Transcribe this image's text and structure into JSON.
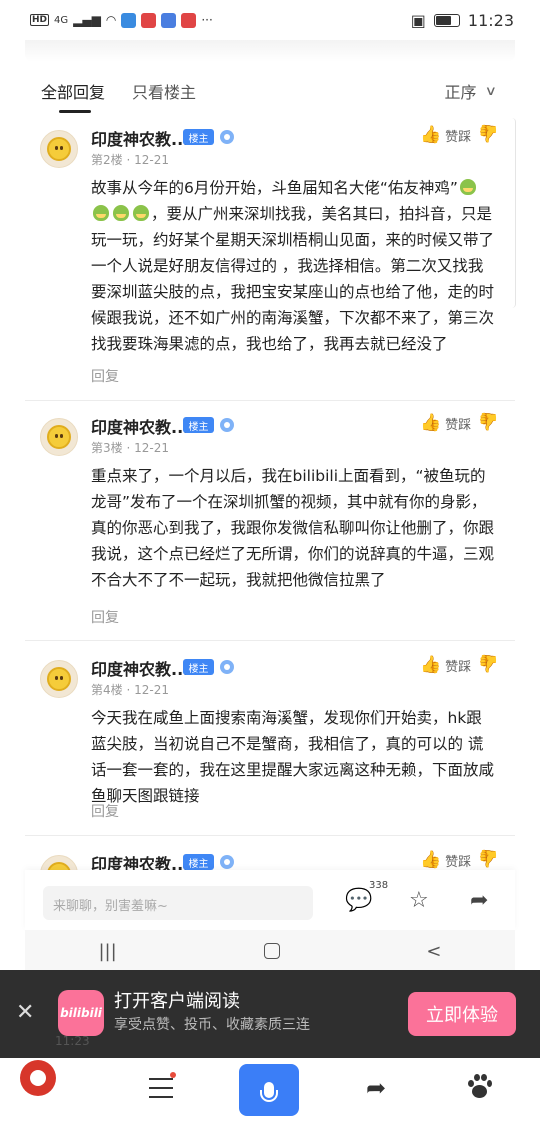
{
  "status_bar": {
    "hd": "HD",
    "network": "4G",
    "time": "11:23",
    "app_colors": [
      "#3a8be0",
      "#e04545",
      "#4a7ee0",
      "#e04545"
    ]
  },
  "tabs": {
    "all": "全部回复",
    "owner_only": "只看楼主",
    "sort": "正序"
  },
  "posts": [
    {
      "user": "印度神农教...",
      "badge": "楼主",
      "floor": "第2楼",
      "date": "12-21",
      "like": "赞踩",
      "text_a": "故事从今年的6月份开始，斗鱼届知名大佬“佑友神鸡”",
      "text_b": "，要从广州来深圳找我，美名其曰，拍抖音，只是玩一玩，约好某个星期天深圳梧桐山见面，来的时候又带了一个人说是好朋友信得过的 ，我选择相信。第二次又找我要深圳蓝尖肢的点，我把宝安某座山的点也给了他，走的时候跟我说，还不如广州的南海溪蟹，下次都不来了，第三次找我要珠海果滤的点，我也给了，我再去就已经没了",
      "reply": "回复"
    },
    {
      "user": "印度神农教...",
      "badge": "楼主",
      "floor": "第3楼",
      "date": "12-21",
      "like": "赞踩",
      "text": "重点来了，一个月以后，我在bilibili上面看到，“被鱼玩的龙哥”发布了一个在深圳抓蟹的视频，其中就有你的身影，真的你恶心到我了，我跟你发微信私聊叫你让他删了，你跟我说，这个点已经烂了无所谓，你们的说辞真的牛逼，三观不合大不了不一起玩，我就把他微信拉黑了",
      "reply": "回复"
    },
    {
      "user": "印度神农教...",
      "badge": "楼主",
      "floor": "第4楼",
      "date": "12-21",
      "like": "赞踩",
      "text": "今天我在咸鱼上面搜索南海溪蟹，发现你们开始卖，hk跟蓝尖肢，当初说自己不是蟹商，我相信了，真的可以的 谎话一套一套的，我在这里提醒大家远离这种无赖，下面放咸鱼聊天图跟链接",
      "reply": "回复"
    },
    {
      "user": "印度神农教...",
      "badge": "楼主",
      "like": "赞踩"
    }
  ],
  "comment_bar": {
    "placeholder": "来聊聊，别害羞嘛~",
    "count": "338"
  },
  "banner": {
    "logo": "bilibili",
    "title": "打开客户端阅读",
    "subtitle": "享受点赞、投币、收藏素质三连",
    "button": "立即体验",
    "ghost_time": "11:23"
  },
  "colors": {
    "accent_blue": "#3f87f5",
    "bili_pink": "#fb7299",
    "banner_bg": "#2f2f2f"
  },
  "icons": [
    "thumb-up-icon",
    "thumb-down-icon",
    "comment-icon",
    "star-icon",
    "share-icon",
    "menu-icon",
    "mic-icon",
    "paw-icon",
    "close-icon"
  ]
}
